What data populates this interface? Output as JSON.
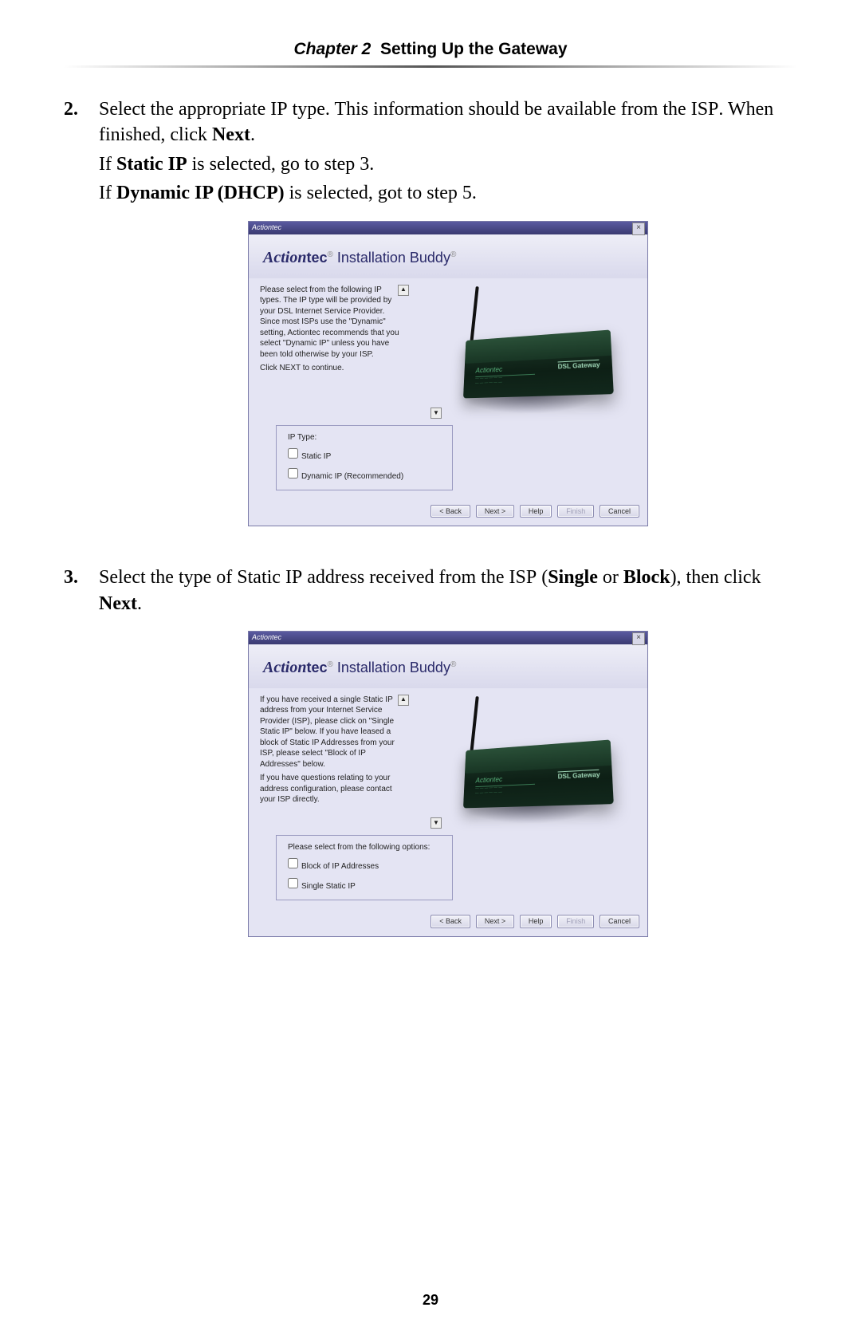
{
  "header": {
    "chapter_label": "Chapter 2",
    "chapter_title": "Setting Up the Gateway"
  },
  "steps": [
    {
      "number": "2.",
      "lines": [
        {
          "pre": "Select the appropriate ",
          "sc": "IP",
          "mid": " type. This information should be available from the ",
          "sc2": "ISP",
          "post": ". When finished, click ",
          "bold": "Next",
          "end": "."
        },
        {
          "pre": "If ",
          "bold": "Static IP",
          "post": " is selected, go to step 3."
        },
        {
          "pre": "If ",
          "bold": "Dynamic IP (DHCP)",
          "post": " is selected, got to step 5."
        }
      ]
    },
    {
      "number": "3.",
      "lines": [
        {
          "pre": "Select the type of Static ",
          "sc": "IP",
          "mid": " address received from the ",
          "sc2": "ISP",
          "post": " (",
          "bold": "Single",
          "mid2": " or ",
          "bold2": "Block",
          "end": "), then click ",
          "bold3": "Next",
          "end2": "."
        }
      ]
    }
  ],
  "dialog_common": {
    "mini_logo": "Actiontec",
    "close": "×",
    "brand_ital": "Action",
    "brand_rest": "tec",
    "brand_reg1": "®",
    "brand_product": " Installation Buddy",
    "brand_reg2": "®",
    "router_logo": "Actiontec",
    "router_label": "DSL Gateway",
    "scroll_up": "▲",
    "scroll_dn": "▼",
    "buttons": {
      "back": "< Back",
      "next": "Next >",
      "help": "Help",
      "finish": "Finish",
      "cancel": "Cancel"
    }
  },
  "dialog1": {
    "para1": "Please select from the following IP types. The IP type will be provided by your DSL Internet Service Provider. Since most ISPs use the \"Dynamic\" setting, Actiontec recommends that you select \"Dynamic IP\" unless you have been told otherwise by your ISP.",
    "para2": "Click NEXT to continue.",
    "legend": "IP Type:",
    "opt1": "Static IP",
    "opt2": "Dynamic IP (Recommended)"
  },
  "dialog2": {
    "para1": "If you have received a single Static IP address from your Internet Service Provider (ISP), please click on \"Single Static IP\" below. If you have leased a block of Static IP Addresses from your ISP, please select \"Block of IP Addresses\" below.",
    "para2": "If you have questions relating to your address configuration, please contact your ISP directly.",
    "legend": "Please select from the following options:",
    "opt1": "Block of IP Addresses",
    "opt2": "Single Static IP"
  },
  "page_number": "29"
}
